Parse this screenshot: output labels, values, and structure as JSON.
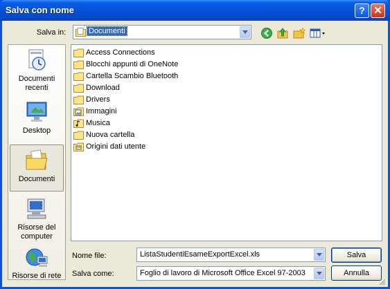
{
  "window": {
    "title": "Salva con nome"
  },
  "titlebar": {
    "help_symbol": "?",
    "close_symbol": "✕"
  },
  "savein": {
    "label": "Salva in:",
    "value": "Documenti"
  },
  "places": [
    {
      "label": "Documenti recenti",
      "icon": "recent-documents-icon"
    },
    {
      "label": "Desktop",
      "icon": "desktop-icon"
    },
    {
      "label": "Documenti",
      "icon": "documents-folder-icon"
    },
    {
      "label": "Risorse del computer",
      "icon": "my-computer-icon"
    },
    {
      "label": "Risorse di rete",
      "icon": "network-places-icon"
    }
  ],
  "files": [
    {
      "name": "Access Connections",
      "icon": "folder-icon"
    },
    {
      "name": "Blocchi appunti di OneNote",
      "icon": "folder-icon"
    },
    {
      "name": "Cartella Scambio Bluetooth",
      "icon": "folder-icon"
    },
    {
      "name": "Download",
      "icon": "folder-icon"
    },
    {
      "name": "Drivers",
      "icon": "folder-icon"
    },
    {
      "name": "Immagini",
      "icon": "pictures-folder-icon"
    },
    {
      "name": "Musica",
      "icon": "music-folder-icon"
    },
    {
      "name": "Nuova cartella",
      "icon": "folder-icon"
    },
    {
      "name": "Origini dati utente",
      "icon": "data-sources-folder-icon"
    }
  ],
  "filename": {
    "label": "Nome file:",
    "value": "ListaStudentiEsameExportExcel.xls"
  },
  "filetype": {
    "label": "Salva come:",
    "value": "Foglio di lavoro di Microsoft Office Excel 97-2003"
  },
  "buttons": {
    "save": "Salva",
    "cancel": "Annulla"
  },
  "colors": {
    "titlebar": "#0752d6",
    "dialog_bg": "#ece9d8",
    "selection": "#316ac5"
  }
}
